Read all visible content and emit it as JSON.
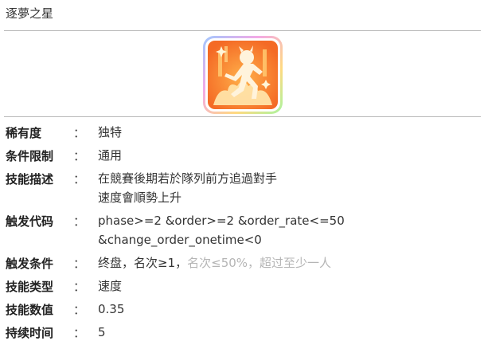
{
  "page_title": "逐夢之星",
  "skill_icon": "skill-speed-runner-icon",
  "colors": {
    "icon_orange": "#f7772c",
    "divider": "#b9b9b9"
  },
  "rows": [
    {
      "label": "稀有度",
      "colon": "：",
      "value_lines": [
        "独特"
      ]
    },
    {
      "label": "条件限制",
      "colon": "：",
      "value_lines": [
        "通用"
      ]
    },
    {
      "label": "技能描述",
      "colon": "：",
      "value_lines": [
        "在競賽後期若於隊列前方追過對手",
        "速度會順勢上升"
      ]
    },
    {
      "label": "触发代码",
      "colon": "：",
      "value_lines": [
        "phase>=2 &order>=2 &order_rate<=50",
        "&change_order_onetime<0"
      ]
    },
    {
      "label": "触发条件",
      "colon": "：",
      "value_parts": [
        "终盘，名次≥1，",
        "名次≤50%，超过至少一人"
      ]
    },
    {
      "label": "技能类型",
      "colon": "：",
      "value_lines": [
        "速度"
      ]
    },
    {
      "label": "技能数值",
      "colon": "：",
      "value_lines": [
        "0.35"
      ]
    },
    {
      "label": "持续时间",
      "colon": "：",
      "value_lines": [
        "5"
      ]
    }
  ]
}
